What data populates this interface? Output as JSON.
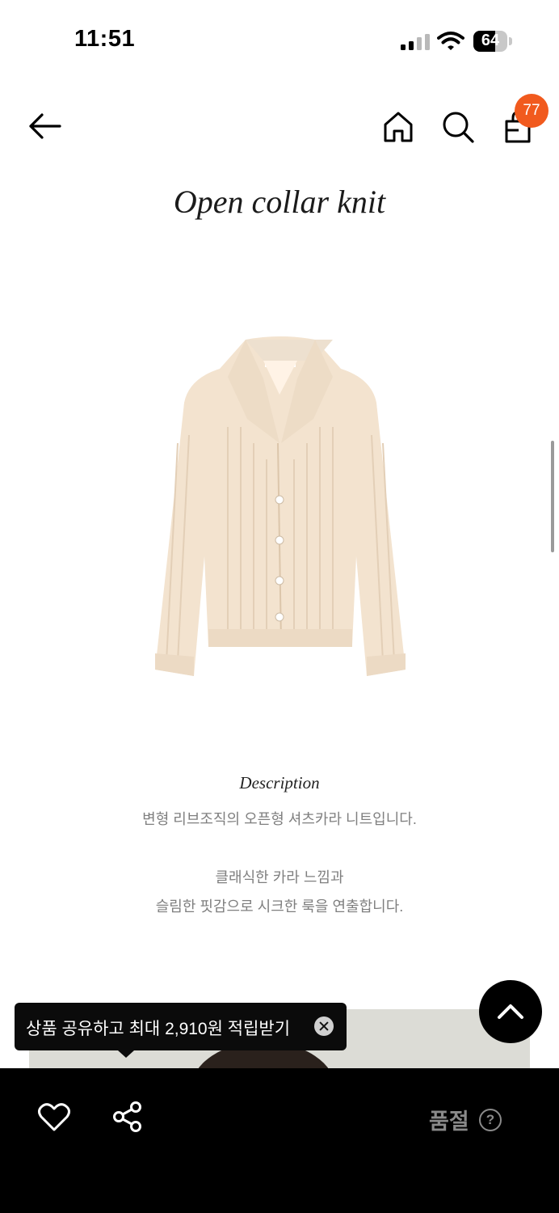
{
  "status_bar": {
    "time": "11:51",
    "battery_level": "64",
    "battery_fraction": 0.64,
    "icons": [
      "cellular-signal-icon",
      "wifi-icon",
      "battery-icon"
    ]
  },
  "nav": {
    "icons": [
      "back-arrow-icon",
      "home-icon",
      "search-icon",
      "shopping-bag-icon"
    ],
    "cart_count": "77",
    "badge_color": "#f15a1e"
  },
  "product": {
    "title": "Open collar knit",
    "image_icon": "open-collar-knit-cardigan",
    "garment_color": "#f3e3cf"
  },
  "description": {
    "heading": "Description",
    "lines": [
      "변형 리브조직의 오픈형 셔츠카라 니트입니다.",
      "클래식한 카라 느낌과",
      "슬림한 핏감으로 시크한 룩을 연출합니다."
    ]
  },
  "share_tooltip": {
    "text": "상품 공유하고 최대 2,910원 적립받기",
    "close_icon": "close-icon"
  },
  "scroll_top": {
    "icon": "chevron-up-icon"
  },
  "bottom_bar": {
    "like_icon": "heart-icon",
    "share_icon": "share-icon",
    "soldout_label": "품절",
    "help_icon_label": "?"
  }
}
